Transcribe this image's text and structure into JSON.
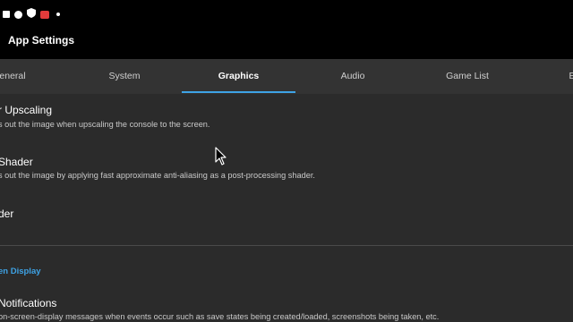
{
  "status_bar": {
    "icons": [
      "square-icon",
      "circle-icon",
      "shield-icon",
      "red-app-icon",
      "dot-icon"
    ]
  },
  "app_bar": {
    "title": "App Settings"
  },
  "tabs": [
    {
      "label": "eneral",
      "active": false
    },
    {
      "label": "System",
      "active": false
    },
    {
      "label": "Graphics",
      "active": true
    },
    {
      "label": "Audio",
      "active": false
    },
    {
      "label": "Game List",
      "active": false
    },
    {
      "label": "E",
      "active": false
    }
  ],
  "accent_color": "#3ea3e6",
  "preferences": [
    {
      "title": "r Upscaling",
      "summary": "s out the image when upscaling the console to the screen."
    },
    {
      "title": "Shader",
      "summary": "s out the image by applying fast approximate anti-aliasing as a post-processing shader."
    },
    {
      "title": "der",
      "summary": ""
    }
  ],
  "section": {
    "header": "en Display"
  },
  "notifications": {
    "title": "Notifications",
    "summary": "on-screen-display messages when events occur such as save states being created/loaded, screenshots being taken, etc."
  }
}
